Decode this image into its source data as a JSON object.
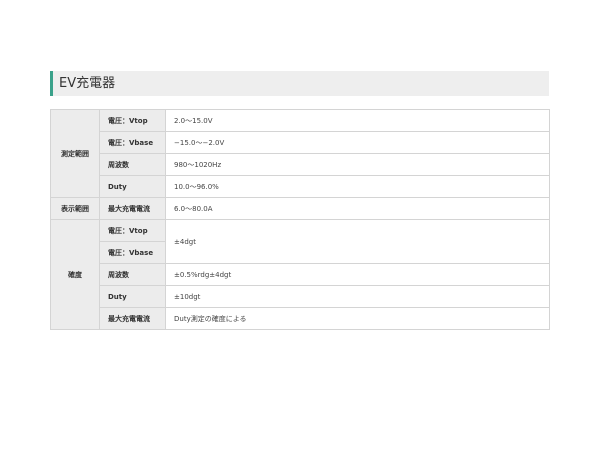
{
  "section": {
    "title": "EV充電器"
  },
  "spec_table": {
    "measurement_range": {
      "category": "測定範囲",
      "rows": [
        {
          "label": "電圧：Vtop",
          "value": "2.0〜15.0V"
        },
        {
          "label": "電圧：Vbase",
          "value": "−15.0〜−2.0V"
        },
        {
          "label": "周波数",
          "value": "980〜1020Hz"
        },
        {
          "label": "Duty",
          "value": "10.0〜96.0%"
        }
      ]
    },
    "display_range": {
      "category": "表示範囲",
      "rows": [
        {
          "label": "最大充電電流",
          "value": "6.0〜80.0A"
        }
      ]
    },
    "accuracy": {
      "category": "確度",
      "voltage_vtop_label": "電圧：Vtop",
      "voltage_vbase_label": "電圧：Vbase",
      "voltage_value": "±4dgt",
      "rows": [
        {
          "label": "周波数",
          "value": "±0.5%rdg±4dgt"
        },
        {
          "label": "Duty",
          "value": "±10dgt"
        },
        {
          "label": "最大充電電流",
          "value": "Duty測定の確度による"
        }
      ]
    }
  },
  "colors": {
    "accent": "#3aa18a",
    "header_bg": "#eeeeee",
    "label_bg": "#ececec",
    "border": "#d4d4d4"
  }
}
